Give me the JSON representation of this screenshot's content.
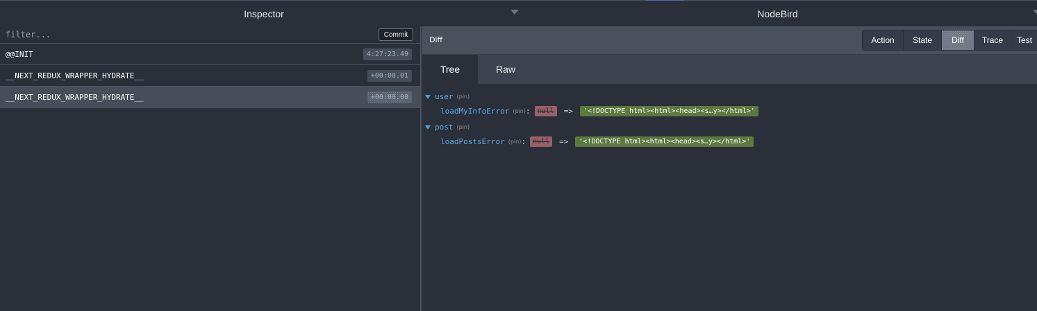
{
  "header": {
    "left_dropdown": "Inspector",
    "right_dropdown": "NodeBird"
  },
  "sidebar": {
    "filter_placeholder": "filter...",
    "commit_label": "Commit",
    "actions": [
      {
        "name": "@@INIT",
        "time": "4:27:23.49"
      },
      {
        "name": "__NEXT_REDUX_WRAPPER_HYDRATE__",
        "time": "+00:00.01"
      },
      {
        "name": "__NEXT_REDUX_WRAPPER_HYDRATE__",
        "time": "+00:00.00"
      }
    ]
  },
  "main": {
    "title": "Diff",
    "tabs": [
      "Action",
      "State",
      "Diff",
      "Trace",
      "Test"
    ],
    "active_tab": "Diff",
    "subtabs": [
      "Tree",
      "Raw"
    ],
    "active_subtab": "Tree",
    "tree": {
      "pin_label": "(pin)",
      "nodes": [
        {
          "key": "user",
          "children": [
            {
              "key": "loadMyInfoError",
              "old": "null",
              "arrow": "=>",
              "new": "'<!DOCTYPE html><html><head><s…y></html>'"
            }
          ]
        },
        {
          "key": "post",
          "children": [
            {
              "key": "loadPostsError",
              "old": "null",
              "arrow": "=>",
              "new": "'<!DOCTYPE html><html><head><s…y></html>'"
            }
          ]
        }
      ]
    }
  },
  "colors": {
    "background": "#2a2f3a",
    "key": "#5aa9e6",
    "removed": "#9a5f67",
    "added": "#5a7a3f"
  }
}
